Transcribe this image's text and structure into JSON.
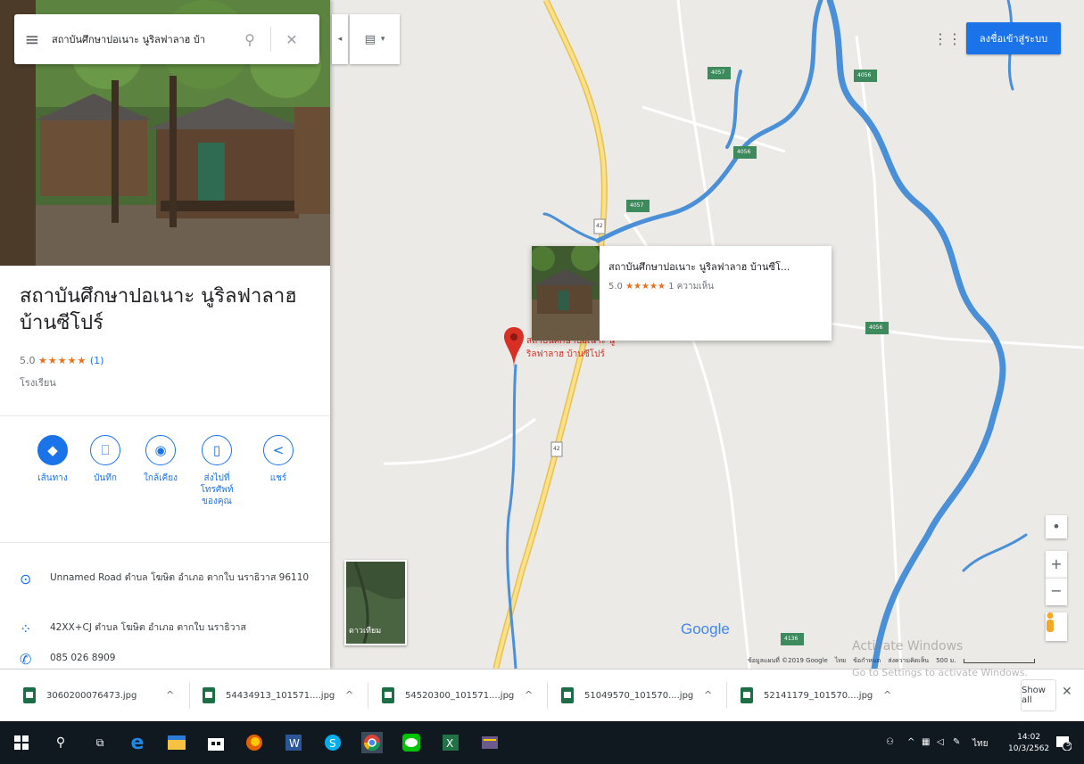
{
  "search": {
    "query": "สถาบันศึกษาปอเนาะ นูริลฟาลาฮ บ้า"
  },
  "header": {
    "signin_label": "ลงชื่อเข้าสู่ระบบ"
  },
  "place": {
    "title": "สถาบันศึกษาปอเนาะ นูริลฟาลาฮ บ้านซีโปร์",
    "rating": "5.0",
    "stars": "★★★★★",
    "review_count": "(1)",
    "category": "โรงเรียน",
    "actions": [
      {
        "label": "เส้นทาง",
        "icon": "directions-icon"
      },
      {
        "label": "บันทึก",
        "icon": "bookmark-icon"
      },
      {
        "label": "ใกล้เคียง",
        "icon": "nearby-icon"
      },
      {
        "label": "ส่งไปที่โทรศัพท์ของคุณ",
        "icon": "send-to-phone-icon"
      },
      {
        "label": "แชร์",
        "icon": "share-icon"
      }
    ],
    "address": "Unnamed Road ตำบล โฆษิต อำเภอ ตากใบ นราธิวาส 96110",
    "plus_code": "42XX+CJ ตำบล โฆษิต อำเภอ ตากใบ นราธิวาส",
    "phone": "085 026 8909"
  },
  "popup": {
    "title": "สถาบันศึกษาปอเนาะ นูริลฟาลาฮ บ้านซีโ...",
    "rating": "5.0",
    "stars": "★★★★★",
    "reviews": "1 ความเห็น"
  },
  "map": {
    "pin_label": "สถาบันศึกษาปอเนาะ นูริลฟาลาฮ บ้านซีโปร์",
    "satellite_label": "ดาวเทียม",
    "google_logo": "Google",
    "footer": {
      "map_data": "ข้อมูลแผนที่ ©2019 Google",
      "thailand": "ไทย",
      "terms": "ข้อกำหนด",
      "feedback": "ส่งความคิดเห็น",
      "scale": "500 ม."
    },
    "road_labels": [
      "4057",
      "4056",
      "4056",
      "4057",
      "4056",
      "4136"
    ],
    "route_shields": [
      "42",
      "42"
    ]
  },
  "watermark": {
    "title": "Activate Windows",
    "subtitle": "Go to Settings to activate Windows."
  },
  "downloads": {
    "files": [
      "3060200076473.jpg",
      "54434913_101571....jpg",
      "54520300_101571....jpg",
      "51049570_101570....jpg",
      "52141179_101570....jpg"
    ],
    "show_all": "Show all"
  },
  "taskbar": {
    "time": "14:02",
    "date": "10/3/2562",
    "lang": "ไทย",
    "notification_count": "5"
  },
  "colors": {
    "accent": "#1a73e8",
    "star": "#e7711b",
    "pin": "#d93025",
    "river": "#4a90d9",
    "highway": "#f9d560",
    "taskbar": "#101820"
  }
}
